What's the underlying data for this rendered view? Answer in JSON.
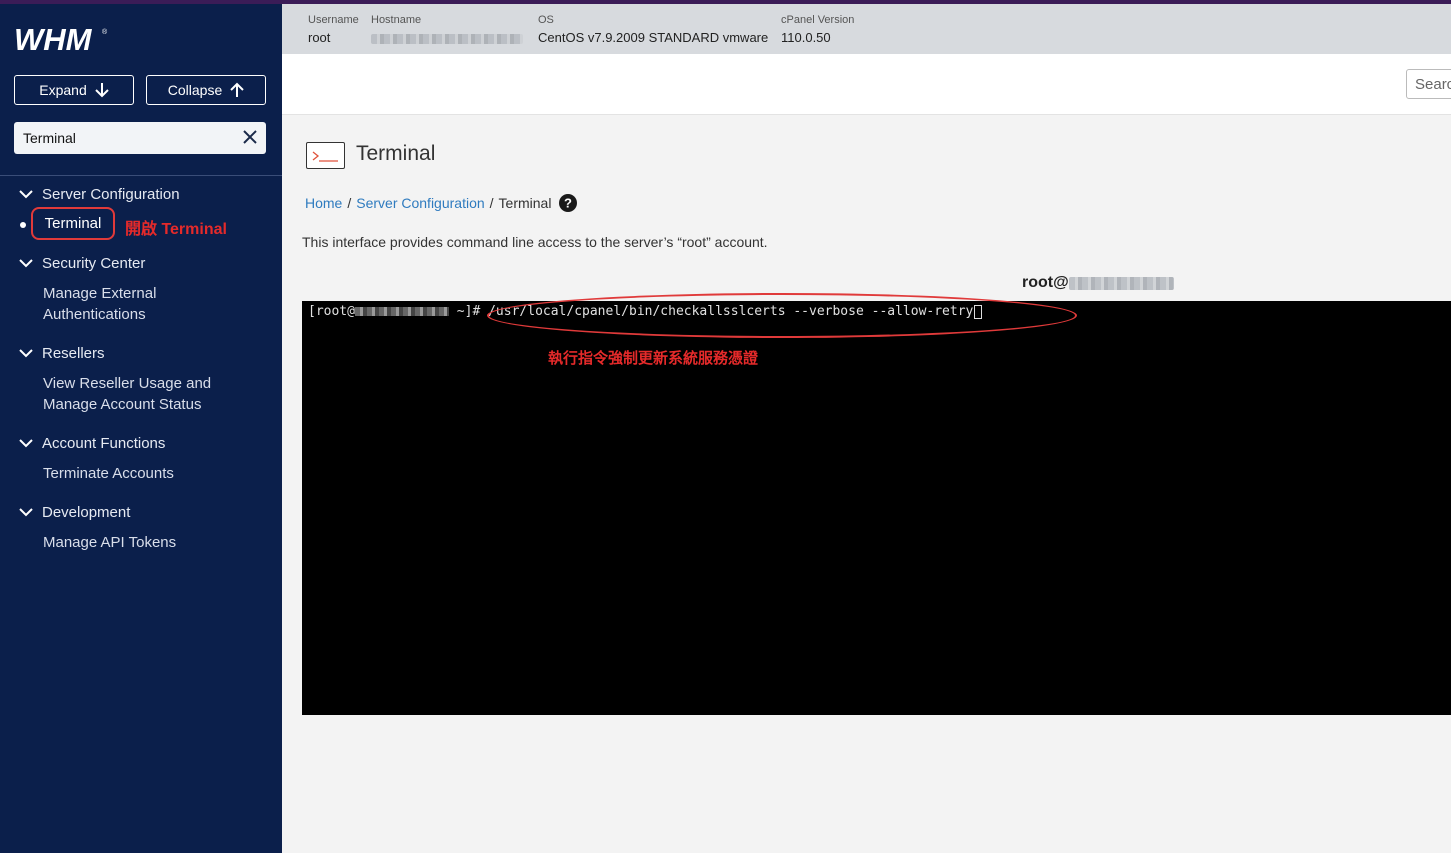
{
  "sidebar": {
    "logo_text": "WHM",
    "expand_label": "Expand",
    "collapse_label": "Collapse",
    "search_value": "Terminal",
    "groups": [
      {
        "title": "Server Configuration",
        "items": [
          "Terminal"
        ]
      },
      {
        "title": "Security Center",
        "items": [
          "Manage External Authentications"
        ]
      },
      {
        "title": "Resellers",
        "items": [
          "View Reseller Usage and Manage Account Status"
        ]
      },
      {
        "title": "Account Functions",
        "items": [
          "Terminate Accounts"
        ]
      },
      {
        "title": "Development",
        "items": [
          "Manage API Tokens"
        ]
      }
    ],
    "annotation_open": "開啟 Terminal"
  },
  "infobar": {
    "username_label": "Username",
    "username": "root",
    "hostname_label": "Hostname",
    "os_label": "OS",
    "os": "CentOS v7.9.2009 STANDARD vmware",
    "cpanel_label": "cPanel Version",
    "cpanel_version": "110.0.50"
  },
  "top_search_placeholder": "Search",
  "page": {
    "title": "Terminal",
    "breadcrumb": [
      "Home",
      "Server Configuration",
      "Terminal"
    ],
    "description": "This interface provides command line access to the server’s “root” account.",
    "root_label": "root@"
  },
  "terminal": {
    "prompt_start": "[root@",
    "prompt_end": " ~]# ",
    "command": "/usr/local/cpanel/bin/checkallsslcerts --verbose --allow-retry"
  },
  "annotation_cmd": "執行指令強制更新系統服務憑證",
  "colors": {
    "sidebar_bg": "#0b1f4b",
    "accent_link": "#2f7bbf",
    "annotation_red": "#e52a2a",
    "terminal_bg": "#000000"
  }
}
